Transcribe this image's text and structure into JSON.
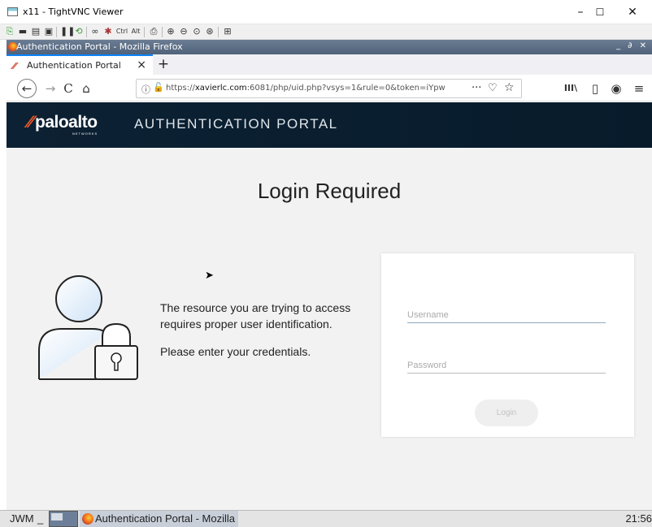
{
  "vnc": {
    "title": "x11 - TightVNC Viewer",
    "controls": {
      "minimize": "–",
      "maximize": "☐",
      "close": "✕"
    },
    "toolbar": {
      "ctrl": "Ctrl",
      "alt": "Alt"
    }
  },
  "remote_window": {
    "title": "Authentication Portal - Mozilla Firefox",
    "controls": "_ ∂ ✕"
  },
  "browser": {
    "tab": {
      "label": "Authentication Portal",
      "close": "×"
    },
    "new_tab": "+",
    "url": {
      "prefix": "https://",
      "domain": "xavierlc.com",
      "rest": ":6081/php/uid.php?vsys=1&rule=0&token=iYpw"
    },
    "icons": {
      "back": "←",
      "forward": "→",
      "reload": "C",
      "home": "⌂",
      "info": "ⓘ",
      "more": "···",
      "pocket": "♡",
      "star": "☆",
      "library": "III\\",
      "sidebar": "▯",
      "extension": "◉",
      "menu": "≡"
    }
  },
  "portal": {
    "logo": "paloalto",
    "logo_sub": "NETWORKS",
    "title": "AUTHENTICATION PORTAL",
    "heading": "Login Required",
    "message_line1": "The resource you are trying to access requires proper user identification.",
    "message_line2": "Please enter your credentials.",
    "username_placeholder": "Username",
    "password_placeholder": "Password",
    "login_label": "Login",
    "colors": {
      "header_bg": "#0c2133",
      "accent": "#f05a28",
      "page_bg": "#f2f2f2"
    }
  },
  "taskbar": {
    "wm_label": "JWM",
    "task_label": "Authentication Portal - Mozilla",
    "clock": "21:56"
  }
}
